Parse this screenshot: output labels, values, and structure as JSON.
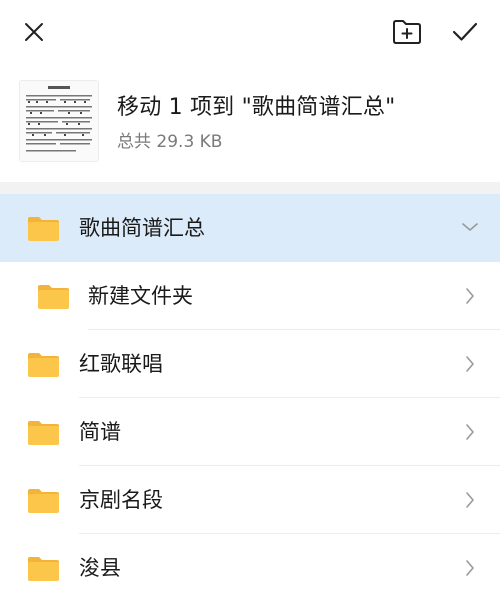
{
  "header": {
    "close_icon": "close-icon",
    "new_folder_icon": "new-folder-icon",
    "confirm_icon": "checkmark-icon"
  },
  "file": {
    "thumbnail_icon": "sheet-music-thumbnail",
    "title": "移动 1 项到 \"歌曲简谱汇总\"",
    "size": "总共 29.3 KB"
  },
  "folders": {
    "current": {
      "label": "歌曲简谱汇总",
      "icon": "folder-icon",
      "expanded": true
    },
    "items": [
      {
        "label": "新建文件夹",
        "icon": "folder-icon"
      },
      {
        "label": "红歌联唱",
        "icon": "folder-icon"
      },
      {
        "label": "简谱",
        "icon": "folder-icon"
      },
      {
        "label": "京剧名段",
        "icon": "folder-icon"
      },
      {
        "label": "浚县",
        "icon": "folder-icon"
      }
    ]
  },
  "colors": {
    "selected_background": "#dcebfa",
    "folder_yellow": "#fcc64a",
    "folder_tab": "#f3b43a"
  }
}
